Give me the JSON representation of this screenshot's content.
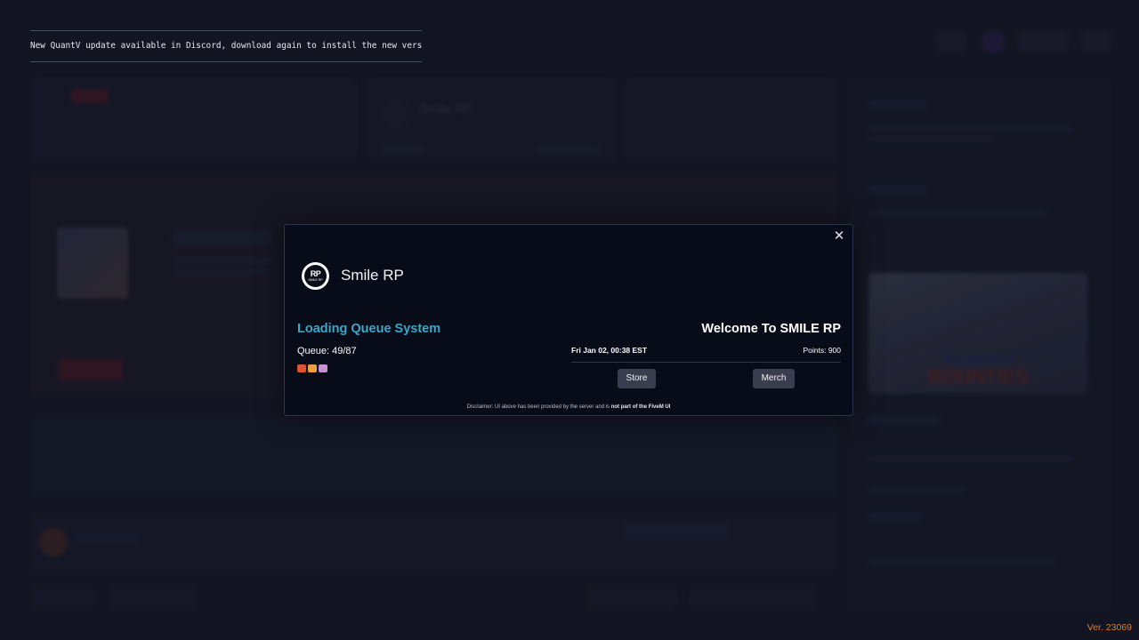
{
  "notification": {
    "text": "New QuantV update available in Discord, download again to install the new version."
  },
  "modal": {
    "server_name": "Smile RP",
    "logo_text": "RP",
    "logo_subtext": "SMILE RP",
    "queue_title": "Loading Queue System",
    "queue_status": "Queue: 49/87",
    "emojis": [
      "#d9552f",
      "#e9a13b",
      "#c78fd6"
    ],
    "welcome": "Welcome To SMILE RP",
    "datetime": "Fri Jan 02, 00:38 EST",
    "points": "Points: 900",
    "store_label": "Store",
    "merch_label": "Merch",
    "close_glyph": "✕",
    "disclaimer_prefix": "Disclaimer: UI above has been provided by the server and is ",
    "disclaimer_bold": "not part of the FiveM UI"
  },
  "background": {
    "server_card_title": "Smile RP",
    "promo_line1": "WANTED DEAD",
    "promo_line2": "BOUNTIES"
  },
  "version": "Ver. 23069",
  "colors": {
    "accent_blue": "#3aa7c9",
    "version_orange": "#e07b2e",
    "modal_bg": "#080c19"
  }
}
